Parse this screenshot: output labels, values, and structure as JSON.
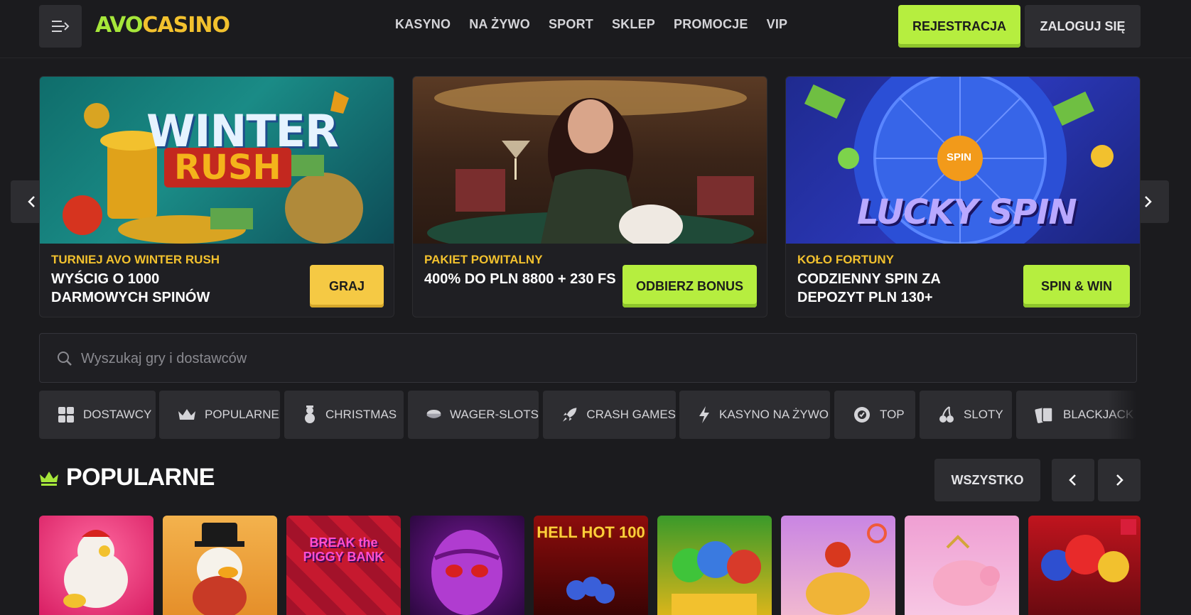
{
  "header": {
    "logo_avo": "AVO",
    "logo_casino": "CASINO",
    "nav": [
      "KASYNO",
      "NA ŻYWO",
      "SPORT",
      "SKLEP",
      "PROMOCJE",
      "VIP"
    ],
    "register": "REJESTRACJA",
    "login": "ZALOGUJ SIĘ"
  },
  "promos": [
    {
      "img_text_1": "WINTER",
      "img_text_2": "RUSH",
      "kicker": "TURNIEJ AVO WINTER RUSH",
      "title": "WYŚCIG O 1000 DARMOWYCH SPINÓW",
      "cta": "GRAJ"
    },
    {
      "kicker": "PAKIET POWITALNY",
      "title": "400% DO PLN 8800 + 230 FS",
      "cta": "ODBIERZ BONUS"
    },
    {
      "img_text_1": "SPIN",
      "img_text_2": "LUCKY SPIN",
      "kicker": "KOŁO FORTUNY",
      "title": "CODZIENNY SPIN ZA DEPOZYT PLN 130+",
      "cta": "SPIN & WIN"
    }
  ],
  "search": {
    "placeholder": "Wyszukaj gry i dostawców"
  },
  "categories": [
    "DOSTAWCY",
    "POPULARNE",
    "CHRISTMAS",
    "WAGER-SLOTS",
    "CRASH GAMES",
    "KASYNO NA ŻYWO",
    "TOP",
    "SLOTY",
    "BLACKJACK"
  ],
  "section": {
    "title": "POPULARNE",
    "all": "WSZYSTKO"
  },
  "games": [
    {
      "label": "",
      "color": "#e0306e"
    },
    {
      "label": "",
      "color": "#f0a640"
    },
    {
      "label": "BREAK the PIGGY BANK",
      "color": "#b8142a"
    },
    {
      "label": "",
      "color": "#5a1270"
    },
    {
      "label": "HELL HOT 100",
      "color": "#6a0a0a"
    },
    {
      "label": "",
      "color": "#c9a21a"
    },
    {
      "label": "",
      "color": "#c07ad8"
    },
    {
      "label": "",
      "color": "#e27fc6"
    },
    {
      "label": "",
      "color": "#8a0a14"
    }
  ]
}
